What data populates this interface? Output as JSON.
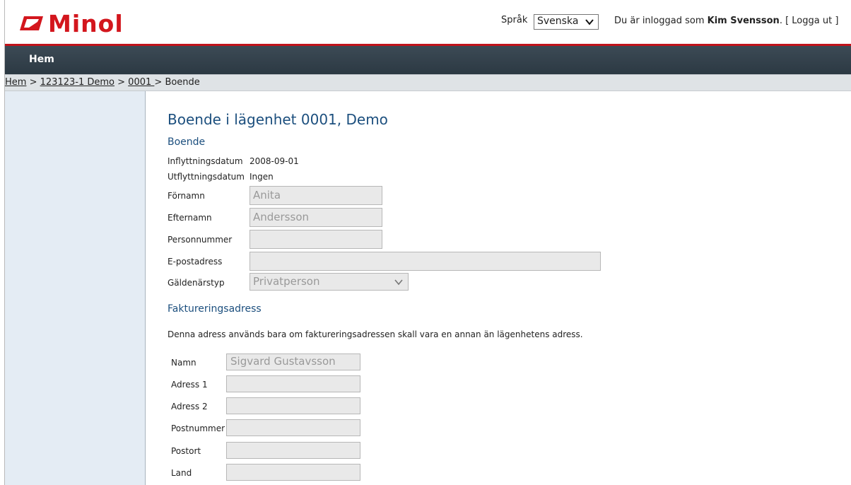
{
  "brand": {
    "logo_text": "Minol",
    "color": "#d3161d"
  },
  "header": {
    "language_label": "Språk",
    "language_selected": "Svenska",
    "login_prefix": "Du är inloggad som",
    "user_name": "Kim Svensson",
    "logout_open": ". [",
    "logout_label": "Logga ut",
    "logout_close": "]"
  },
  "nav": {
    "home_label": "Hem"
  },
  "breadcrumb": {
    "items": [
      "Hem",
      "123123-1 Demo",
      "0001 ",
      "Boende"
    ],
    "separator": ">"
  },
  "page": {
    "title": "Boende i lägenhet 0001, Demo"
  },
  "boende": {
    "section_title": "Boende",
    "move_in_label": "Inflyttningsdatum",
    "move_in_value": "2008-09-01",
    "move_out_label": "Utflyttningsdatum",
    "move_out_value": "Ingen",
    "first_name_label": "Förnamn",
    "first_name_value": "Anita",
    "last_name_label": "Efternamn",
    "last_name_value": "Andersson",
    "personal_number_label": "Personnummer",
    "personal_number_value": "",
    "email_label": "E-postadress",
    "email_value": "",
    "debtor_type_label": "Gäldenärstyp",
    "debtor_type_value": "Privatperson"
  },
  "billing": {
    "section_title": "Faktureringsadress",
    "note": "Denna adress används bara om faktureringsadressen skall vara en annan än lägenhetens adress.",
    "name_label": "Namn",
    "name_value": "Sigvard Gustavsson",
    "address1_label": "Adress 1",
    "address1_value": "",
    "address2_label": "Adress 2",
    "address2_value": "",
    "postal_code_label": "Postnummer",
    "postal_code_value": "",
    "city_label": "Postort",
    "city_value": "",
    "country_label": "Land",
    "country_value": ""
  },
  "icons": {
    "logo": "minol-logo-icon",
    "chevron": "chevron-down-icon"
  },
  "colors": {
    "nav": "#2f3c46",
    "accent_red": "#c1121a",
    "heading": "#1c4f7e",
    "left_panel": "#e4ecf4"
  }
}
